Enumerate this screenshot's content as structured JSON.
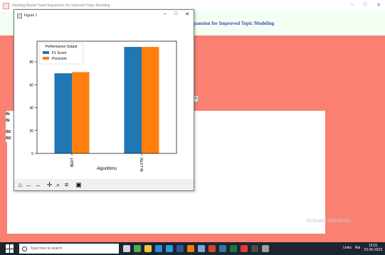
{
  "app": {
    "title": "Hashtag Based Tweet Expansion for Improved Topic Modeling",
    "header_text": "pansion for Improved Topic Modeling",
    "minimize": "–",
    "maximize": "□",
    "close": "✕",
    "left_labels": [
      "Bi",
      "Bi",
      "BE",
      "BE"
    ],
    "side_button": "×",
    "watermark": "Activate Windows",
    "colors": {
      "background": "#fa8072",
      "header": "#f4fff4",
      "header_text": "#3e4fb8"
    }
  },
  "figure": {
    "title": "Figure 1",
    "minimize": "–",
    "maximize": "□",
    "close": "✕",
    "toolbar": [
      {
        "name": "home-icon",
        "glyph": "⌂"
      },
      {
        "name": "back-arrow-icon",
        "glyph": "←"
      },
      {
        "name": "forward-arrow-icon",
        "glyph": "→"
      },
      {
        "name": "pan-icon",
        "glyph": "✛"
      },
      {
        "name": "zoom-icon",
        "glyph": "⌕"
      },
      {
        "name": "configure-subplots-icon",
        "glyph": "≡"
      },
      {
        "name": "save-icon",
        "glyph": "▣"
      }
    ]
  },
  "chart_data": {
    "type": "bar",
    "categories": [
      "BERT",
      "Bi-LSTM"
    ],
    "series": [
      {
        "name": "F1 Score",
        "values": [
          70,
          93
        ],
        "color": "#1f77b4"
      },
      {
        "name": "Precision",
        "values": [
          71,
          93
        ],
        "color": "#ff7f0e"
      }
    ],
    "legend_title": "Performance Output",
    "legend_position": "top-left",
    "xlabel": "Algorithms",
    "ylabel": "",
    "ylim": [
      0,
      98
    ],
    "yticks": [
      0,
      20,
      40,
      60,
      80
    ],
    "grid": false
  },
  "taskbar": {
    "search_placeholder": "Type here to search",
    "tray_links": "Links",
    "tray_weather": "Rai",
    "time": "15:01",
    "date": "23-05-2023",
    "icons": [
      {
        "name": "task-view-icon",
        "color": "#cfd6dc"
      },
      {
        "name": "chrome-icon",
        "color": "#4caf50"
      },
      {
        "name": "file-explorer-icon",
        "color": "#f5c242"
      },
      {
        "name": "store-icon",
        "color": "#2e8bd6"
      },
      {
        "name": "edge-icon",
        "color": "#2b9ad9"
      },
      {
        "name": "word-icon",
        "color": "#2b5797"
      },
      {
        "name": "firefox-icon",
        "color": "#f57c00"
      },
      {
        "name": "notepad-icon",
        "color": "#7aa6d8"
      },
      {
        "name": "powerpoint-icon",
        "color": "#d24726"
      },
      {
        "name": "python-icon",
        "color": "#3572a5"
      },
      {
        "name": "excel-icon",
        "color": "#217346"
      },
      {
        "name": "pdf-icon",
        "color": "#e53935"
      },
      {
        "name": "terminal-icon",
        "color": "#4a4a4a"
      },
      {
        "name": "settings-icon",
        "color": "#9e9e9e"
      }
    ]
  }
}
